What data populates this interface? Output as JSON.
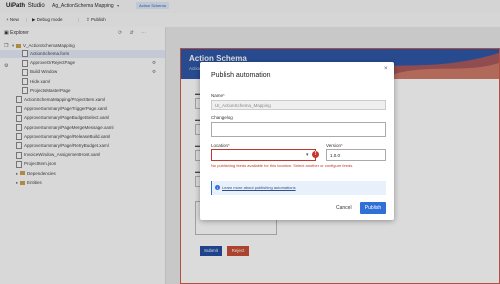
{
  "titlebar": {
    "app_name": "UiPath",
    "app_suffix": "Studio",
    "project": "Ag_ActionSchema Mapping",
    "badge": "Action Schema"
  },
  "toolbar": {
    "items": [
      "New",
      "Debug mode",
      "Publish"
    ]
  },
  "explorer": {
    "title": "Explorer",
    "tools": "⟳ ⇵ ⋯",
    "root": "V_ActionSchemaMapping",
    "items": [
      {
        "label": "ActionSchema.form",
        "selected": true
      },
      {
        "label": "ApproveOrRejectPage"
      },
      {
        "label": "Build Window"
      },
      {
        "label": "Hide.xaml"
      },
      {
        "label": "ProjectsMasterPage"
      },
      {
        "label": "ActionSchemaMapping/ProjectItem.xaml"
      },
      {
        "label": "ApproveSummary/PageTriggerPage.xaml"
      },
      {
        "label": "ApproveSummary/PageBudgetSelect.xaml"
      },
      {
        "label": "ApproveSummary/PageMergeMessage.xaml"
      },
      {
        "label": "ApproveSummary/Page/ReleaseBuild.xaml"
      },
      {
        "label": "ApproveSummary/Page/RetryBudget.xaml"
      },
      {
        "label": "InvoiceWindow_AssignmentHost.xaml"
      },
      {
        "label": "ProjectItem.json"
      },
      {
        "label": "Dependencies"
      },
      {
        "label": "Entities"
      }
    ]
  },
  "document": {
    "title": "Action Schema",
    "subtitle": "Action",
    "submit_label": "Submit",
    "reject_label": "Reject"
  },
  "modal": {
    "title": "Publish automation",
    "close": "×",
    "name_label": "Name",
    "name_value": "UI_ActionSchema_Mapping",
    "changelog_label": "Changelog",
    "location_label": "Location",
    "version_label": "Version",
    "version_value": "1.0.0",
    "error_text": "No publishing feeds available for this location. Select another or configure feeds.",
    "info_text": "Learn more about publishing automations",
    "cancel_label": "Cancel",
    "publish_label": "Publish"
  }
}
